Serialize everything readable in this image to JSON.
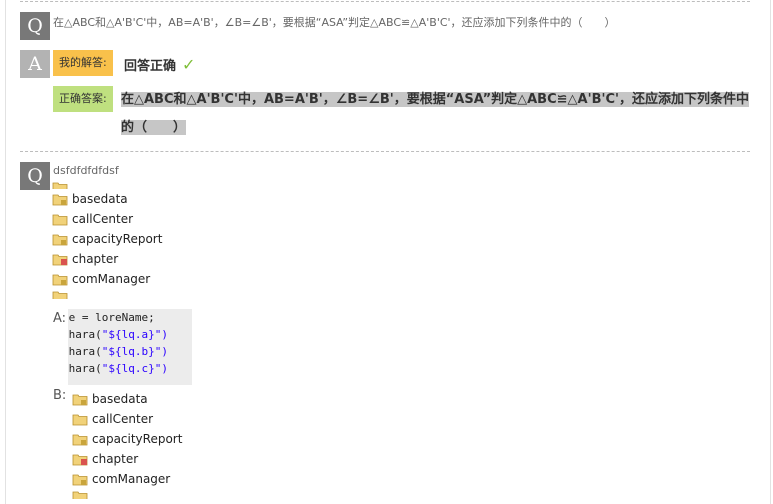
{
  "question1": {
    "badge": "Q",
    "text": "在△ABC和△A'B'C'中，AB=A'B'，∠B=∠B'，要根据“ASA”判定△ABC≌△A'B'C'，还应添加下列条件中的（　　）"
  },
  "answer1": {
    "badge": "A",
    "my_answer_label": "我的解答:",
    "result_text": "回答正确",
    "correct_label": "正确答案:",
    "correct_text": "在△ABC和△A'B'C'中，AB=A'B'，∠B=∠B'，要根据“ASA”判定△ABC≌△A'B'C'，还应添加下列条件中的（　　）"
  },
  "question2": {
    "badge": "Q",
    "text": "dsfdfdfdfdsf",
    "tree_items": [
      "basedata",
      "callCenter",
      "capacityReport",
      "chapter",
      "comManager"
    ],
    "option_a_label": "A:",
    "code_lines": [
      {
        "code": "ie = loreName;",
        "str": ""
      },
      {
        "code": "Chara(",
        "str": "\"${lq.a}\")"
      },
      {
        "code": "Chara(",
        "str": "\"${lq.b}\")"
      },
      {
        "code": "Chara(",
        "str": "\"${lq.c}\")"
      }
    ],
    "option_b_label": "B:"
  },
  "icons": {
    "folder": "folder-icon",
    "check": "checkmark-icon"
  },
  "colors": {
    "badge_q": "#787878",
    "badge_a": "#b3b3b3",
    "my_answer_tag": "#f9c14b",
    "correct_tag": "#bfe07f",
    "check": "#7fbf3a"
  }
}
